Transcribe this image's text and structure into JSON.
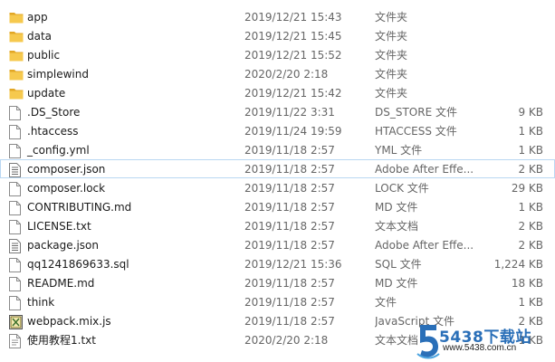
{
  "colors": {
    "folder": "#f6c94e",
    "folder_dark": "#e2a726",
    "selection_border": "#b9d7f2",
    "brand": "#2a6fb8"
  },
  "files": [
    {
      "name": "app",
      "date": "2019/12/21 15:43",
      "type": "文件夹",
      "size": "",
      "icon": "folder-icon"
    },
    {
      "name": "data",
      "date": "2019/12/21 15:45",
      "type": "文件夹",
      "size": "",
      "icon": "folder-icon"
    },
    {
      "name": "public",
      "date": "2019/12/21 15:52",
      "type": "文件夹",
      "size": "",
      "icon": "folder-icon"
    },
    {
      "name": "simplewind",
      "date": "2020/2/20 2:18",
      "type": "文件夹",
      "size": "",
      "icon": "folder-icon"
    },
    {
      "name": "update",
      "date": "2019/12/21 15:42",
      "type": "文件夹",
      "size": "",
      "icon": "folder-icon"
    },
    {
      "name": ".DS_Store",
      "date": "2019/11/22 3:31",
      "type": "DS_STORE 文件",
      "size": "9 KB",
      "icon": "blank-file-icon"
    },
    {
      "name": ".htaccess",
      "date": "2019/11/24 19:59",
      "type": "HTACCESS 文件",
      "size": "1 KB",
      "icon": "blank-file-icon"
    },
    {
      "name": "_config.yml",
      "date": "2019/11/18 2:57",
      "type": "YML 文件",
      "size": "1 KB",
      "icon": "blank-file-icon"
    },
    {
      "name": "composer.json",
      "date": "2019/11/18 2:57",
      "type": "Adobe After Effe...",
      "size": "2 KB",
      "icon": "json-file-icon",
      "selected": true
    },
    {
      "name": "composer.lock",
      "date": "2019/11/18 2:57",
      "type": "LOCK 文件",
      "size": "29 KB",
      "icon": "blank-file-icon"
    },
    {
      "name": "CONTRIBUTING.md",
      "date": "2019/11/18 2:57",
      "type": "MD 文件",
      "size": "1 KB",
      "icon": "blank-file-icon"
    },
    {
      "name": "LICENSE.txt",
      "date": "2019/11/18 2:57",
      "type": "文本文档",
      "size": "2 KB",
      "icon": "blank-file-icon"
    },
    {
      "name": "package.json",
      "date": "2019/11/18 2:57",
      "type": "Adobe After Effe...",
      "size": "2 KB",
      "icon": "json-file-icon"
    },
    {
      "name": "qq1241869633.sql",
      "date": "2019/12/21 15:36",
      "type": "SQL 文件",
      "size": "1,224 KB",
      "icon": "blank-file-icon"
    },
    {
      "name": "README.md",
      "date": "2019/11/18 2:57",
      "type": "MD 文件",
      "size": "18 KB",
      "icon": "blank-file-icon"
    },
    {
      "name": "think",
      "date": "2019/11/18 2:57",
      "type": "文件",
      "size": "1 KB",
      "icon": "blank-file-icon"
    },
    {
      "name": "webpack.mix.js",
      "date": "2019/11/18 2:57",
      "type": "JavaScript 文件",
      "size": "2 KB",
      "icon": "js-file-icon"
    },
    {
      "name": "使用教程1.txt",
      "date": "2020/2/20 2:18",
      "type": "文本文档",
      "size": "1 KB",
      "icon": "text-file-icon"
    }
  ],
  "watermark": {
    "brand": "5438下载站",
    "url": "www.5438.com.cn"
  }
}
